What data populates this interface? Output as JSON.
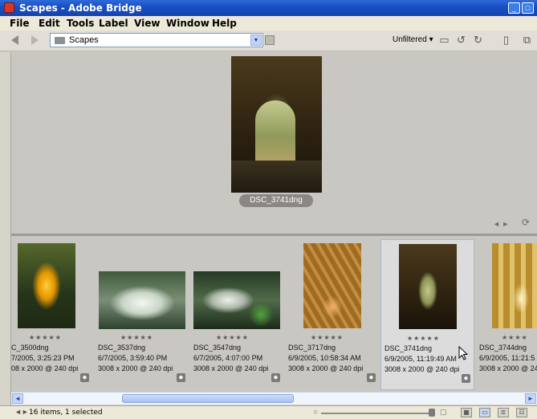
{
  "window": {
    "title": "Scapes - Adobe Bridge",
    "colors": {
      "titlebar": "#1a4fc4",
      "accent": "#d9362b"
    }
  },
  "menu": [
    "File",
    "Edit",
    "Tools",
    "Label",
    "View",
    "Window",
    "Help"
  ],
  "toolbar": {
    "path": "Scapes",
    "filter_label": "Unfiltered",
    "icons": [
      "back-arrow-icon",
      "forward-arrow-icon",
      "folder-icon",
      "new-folder-icon",
      "rotate-left-icon",
      "rotate-right-icon",
      "trash-icon",
      "compact-mode-icon"
    ]
  },
  "preview": {
    "caption": "DSC_3741dng"
  },
  "thumbnails": [
    {
      "name": "C_3500dng",
      "date": "7/2005, 3:25:23 PM",
      "dims": "08 x 2000 @ 240 dpi",
      "stars": "★★★★★",
      "selected": false
    },
    {
      "name": "DSC_3537dng",
      "date": "6/7/2005, 3:59:40 PM",
      "dims": "3008 x 2000 @ 240 dpi",
      "stars": "★★★★★",
      "selected": false
    },
    {
      "name": "DSC_3547dng",
      "date": "6/7/2005, 4:07:00 PM",
      "dims": "3008 x 2000 @ 240 dpi",
      "stars": "★★★★★",
      "selected": false
    },
    {
      "name": "DSC_3717dng",
      "date": "6/9/2005, 10:58:34 AM",
      "dims": "3008 x 2000 @ 240 dpi",
      "stars": "★★★★★",
      "selected": false
    },
    {
      "name": "DSC_3741dng",
      "date": "6/9/2005, 11:19:49 AM",
      "dims": "3008 x 2000 @ 240 dpi",
      "stars": "★★★★★",
      "selected": true
    },
    {
      "name": "DSC_3744dng",
      "date": "6/9/2005, 11:21:5",
      "dims": "3008 x 2000 @ 240",
      "stars": "★★★★",
      "selected": false
    }
  ],
  "status": {
    "text": "16 items, 1 selected"
  }
}
